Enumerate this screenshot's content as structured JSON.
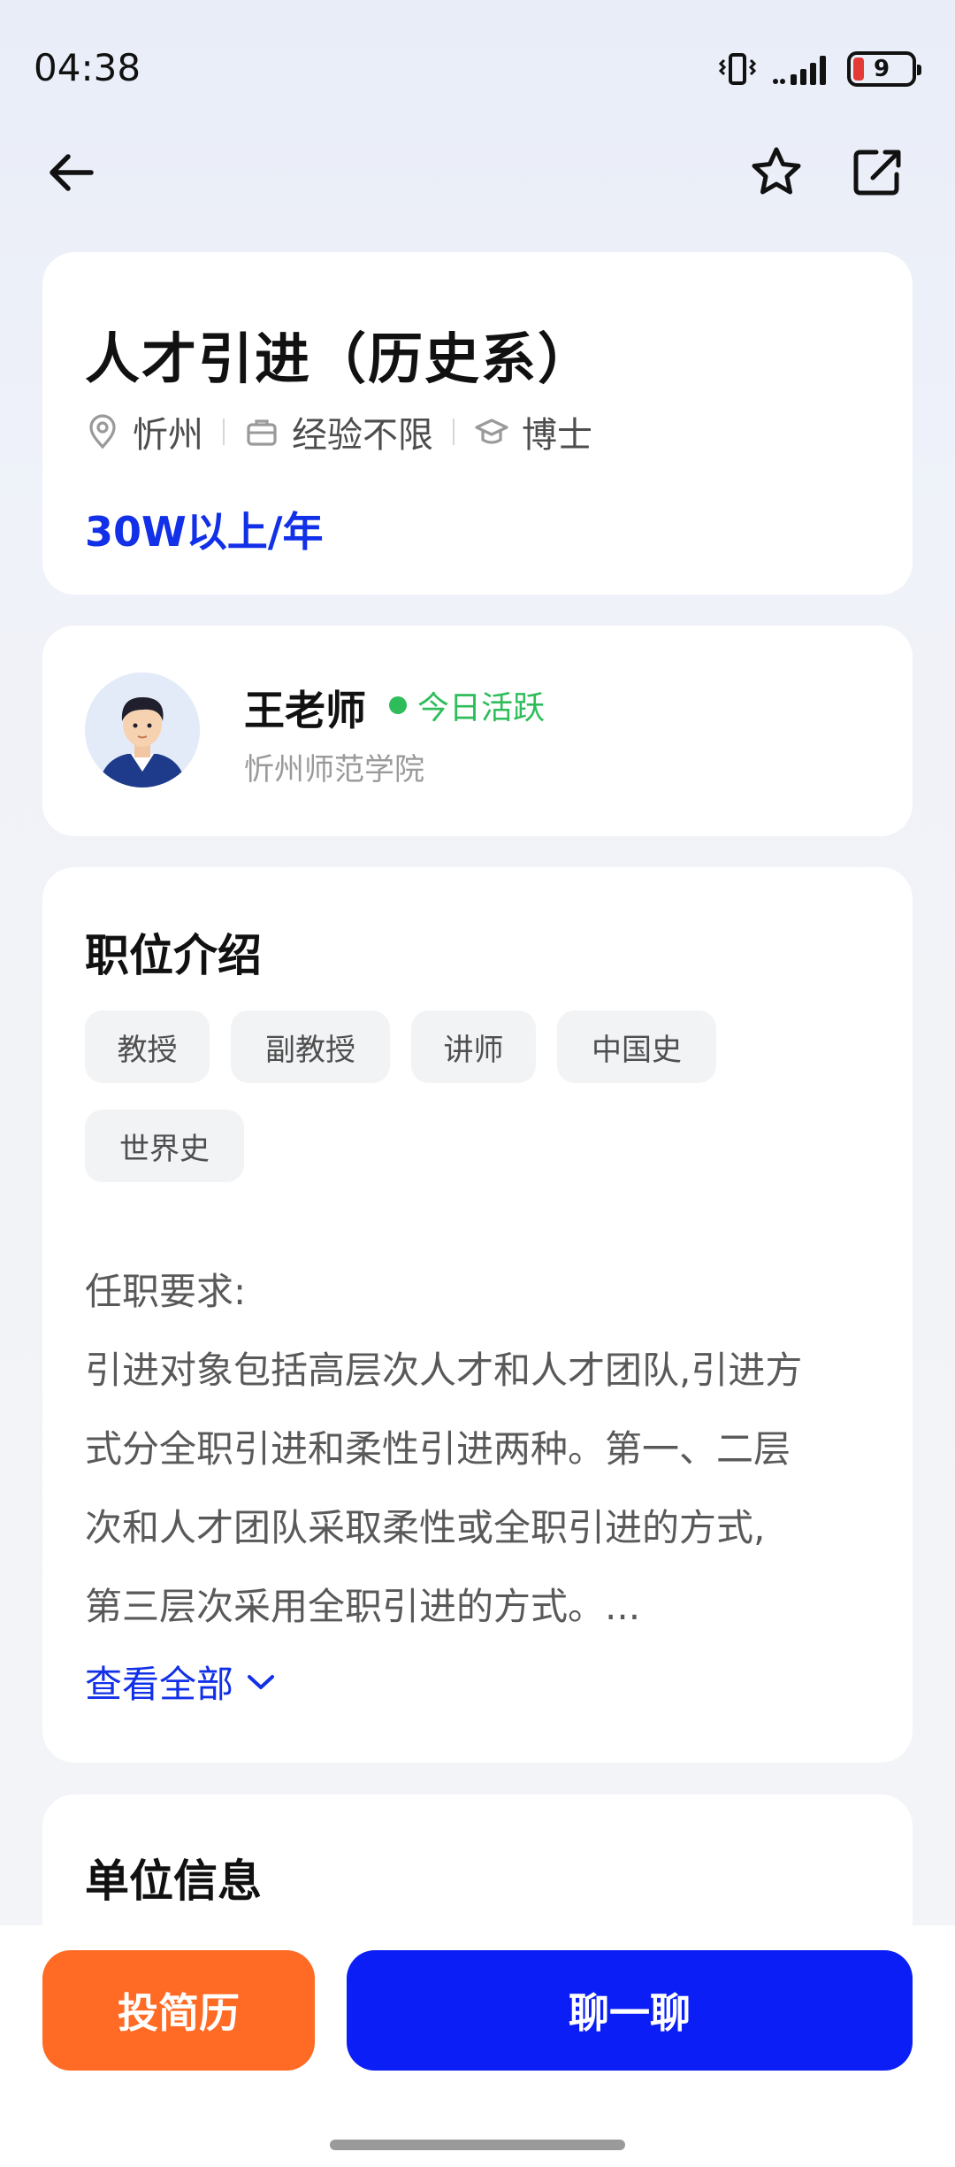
{
  "status_bar": {
    "time": "04:38",
    "battery_level": "9",
    "icons": [
      "vibrate-icon",
      "signal-icon",
      "battery-icon"
    ],
    "battery_color": "#e53935"
  },
  "nav": {
    "icons": [
      "back-arrow-icon",
      "star-icon",
      "share-icon"
    ]
  },
  "job": {
    "title": "人才引进（历史系）",
    "location": "忻州",
    "experience": "经验不限",
    "education": "博士",
    "salary": "30W以上/年",
    "salary_color": "#1230e8"
  },
  "contact": {
    "name": "王老师",
    "status": "今日活跃",
    "status_color": "#2ebd5a",
    "organization": "忻州师范学院"
  },
  "description": {
    "title": "职位介绍",
    "tags": [
      "教授",
      "副教授",
      "讲师",
      "中国史",
      "世界史"
    ],
    "lines": [
      "任职要求:",
      "引进对象包括高层次人才和人才团队,引进方",
      "式分全职引进和柔性引进两种。第一、二层",
      "次和人才团队采取柔性或全职引进的方式,",
      "第三层次采用全职引进的方式。..."
    ],
    "view_all": "查看全部"
  },
  "company": {
    "title": "单位信息"
  },
  "actions": {
    "resume_label": "投简历",
    "chat_label": "聊一聊",
    "resume_color": "#ff6a24",
    "chat_color": "#0a1ef5"
  }
}
